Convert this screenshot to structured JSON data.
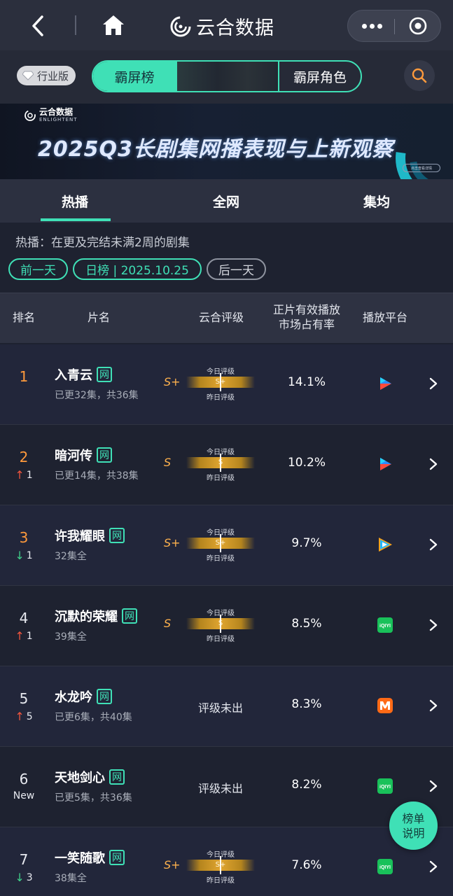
{
  "nav": {
    "brand": "云合数据",
    "icons": [
      "chevron-left-icon",
      "home-icon",
      "more-icon",
      "close-target-icon"
    ]
  },
  "toolbar": {
    "edition_label": "行业版",
    "segments": [
      "霸屏榜",
      "",
      "霸屏角色"
    ],
    "active_segment": 0,
    "search_icon": "search-icon"
  },
  "banner": {
    "logo_cn": "云合数据",
    "logo_en": "ENLIGHTENT",
    "title": "2025Q3长剧集网播表现与上新观察",
    "button": "点击查看详情"
  },
  "tabs": [
    {
      "label": "热播",
      "active": true
    },
    {
      "label": "全网",
      "active": false
    },
    {
      "label": "集均",
      "active": false
    }
  ],
  "description": "热播：在更及完结未满2周的剧集",
  "date_controls": {
    "prev": "前一天",
    "current": "日榜 | 2025.10.25",
    "next": "后一天"
  },
  "table": {
    "headers": {
      "rank": "排名",
      "title": "片名",
      "grade": "云合评级",
      "share_line1": "正片有效播放",
      "share_line2": "市场占有率",
      "platform": "播放平台"
    },
    "grade_top_label": "今日评级",
    "grade_bottom_label": "昨日评级",
    "unrated_label": "评级未出",
    "net_badge": "网",
    "rows": [
      {
        "rank": "1",
        "change_dir": "",
        "change": "",
        "title": "入青云",
        "sub": "已更32集，共36集",
        "grade": "S+",
        "bar": "S+",
        "share": "14.1%",
        "platform": "youku"
      },
      {
        "rank": "2",
        "change_dir": "up",
        "change": "1",
        "title": "暗河传",
        "sub": "已更14集，共38集",
        "grade": "S",
        "bar": "S",
        "share": "10.2%",
        "platform": "youku"
      },
      {
        "rank": "3",
        "change_dir": "down",
        "change": "1",
        "title": "许我耀眼",
        "sub": "32集全",
        "grade": "S+",
        "bar": "S+",
        "share": "9.7%",
        "platform": "tencent"
      },
      {
        "rank": "4",
        "change_dir": "up",
        "change": "1",
        "title": "沉默的荣耀",
        "sub": "39集全",
        "grade": "S",
        "bar": "S",
        "share": "8.5%",
        "platform": "iqiyi"
      },
      {
        "rank": "5",
        "change_dir": "up",
        "change": "5",
        "title": "水龙吟",
        "sub": "已更6集，共40集",
        "grade": "",
        "bar": "",
        "share": "8.3%",
        "platform": "mgtv"
      },
      {
        "rank": "6",
        "change_dir": "new",
        "change": "New",
        "title": "天地剑心",
        "sub": "已更5集，共36集",
        "grade": "",
        "bar": "",
        "share": "8.2%",
        "platform": "iqiyi"
      },
      {
        "rank": "7",
        "change_dir": "down",
        "change": "3",
        "title": "一笑随歌",
        "sub": "38集全",
        "grade": "S+",
        "bar": "S+",
        "share": "7.6%",
        "platform": "iqiyi"
      }
    ]
  },
  "float_button": {
    "line1": "榜单",
    "line2": "说明"
  },
  "platform_labels": {
    "iqiyi": "iQIYI"
  },
  "colors": {
    "accent": "#3fe0b6",
    "rank_top": "#ff9a3c",
    "up": "#f0553e",
    "down": "#3fd08a",
    "grade": "#ffb24d"
  }
}
